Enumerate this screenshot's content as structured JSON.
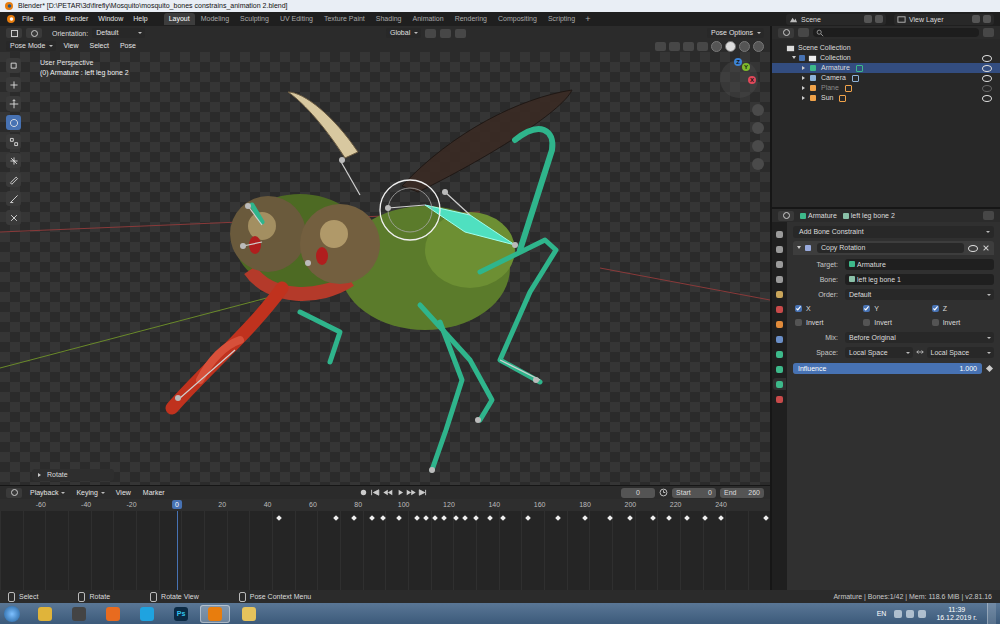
{
  "window": {
    "title": "Blender* [D:\\PETAR\\3d\\firefly\\Mosquito\\mosquito_bones constrains_animation 2.blend]"
  },
  "menu": [
    "File",
    "Edit",
    "Render",
    "Window",
    "Help"
  ],
  "workspaces": [
    {
      "label": "Layout",
      "selected": true
    },
    {
      "label": "Modeling",
      "selected": false
    },
    {
      "label": "Sculpting",
      "selected": false
    },
    {
      "label": "UV Editing",
      "selected": false
    },
    {
      "label": "Texture Paint",
      "selected": false
    },
    {
      "label": "Shading",
      "selected": false
    },
    {
      "label": "Animation",
      "selected": false
    },
    {
      "label": "Rendering",
      "selected": false
    },
    {
      "label": "Compositing",
      "selected": false
    },
    {
      "label": "Scripting",
      "selected": false
    }
  ],
  "add_workspace": "+",
  "scene": "Scene",
  "view_layer": "View Layer",
  "viewport": {
    "orientation_label": "Orientation:",
    "orientation": "Default",
    "transform_orientation": "Global",
    "pose_options": "Pose Options",
    "mode": "Pose Mode",
    "menus": [
      "View",
      "Select",
      "Pose"
    ],
    "perspective": "User Perspective",
    "active": "(0) Armature : left leg bone 2",
    "tools": [
      {
        "selected": false
      },
      {
        "selected": false
      },
      {
        "selected": false
      },
      {
        "selected": true
      },
      {
        "selected": false
      },
      {
        "selected": false
      },
      {
        "selected": false
      },
      {
        "selected": false
      },
      {
        "selected": false
      }
    ],
    "gizmo": [
      {
        "label": "X",
        "color": "#e0485a"
      },
      {
        "label": "Y",
        "color": "#7fba2c"
      },
      {
        "label": "Z",
        "color": "#3c83d6"
      }
    ],
    "last_operator": {
      "label": "Rotate",
      "expanded": false
    }
  },
  "timeline": {
    "menus": [
      "Playback",
      "Keying",
      "View",
      "Marker"
    ],
    "current_frame": "0",
    "start_label": "Start",
    "start": "0",
    "end_label": "End",
    "end": "260",
    "playhead": "0",
    "ruler": [
      "-60",
      "-40",
      "-20",
      "20",
      "40",
      "60",
      "80",
      "100",
      "120",
      "140",
      "160",
      "180",
      "200",
      "220",
      "240"
    ],
    "keyframes": [
      45,
      70,
      78,
      86,
      91,
      98,
      106,
      110,
      114,
      118,
      123,
      127,
      132,
      138,
      144,
      155,
      168,
      180,
      191,
      200,
      210,
      217,
      225,
      233,
      240,
      260
    ]
  },
  "outliner": {
    "root": "Scene Collection",
    "collection": {
      "label": "Collection",
      "expanded": true,
      "items": [
        {
          "label": "Armature",
          "selected": true,
          "visible": true
        },
        {
          "label": "Camera",
          "selected": false,
          "visible": true
        },
        {
          "label": "Plane",
          "selected": false,
          "visible": false
        },
        {
          "label": "Sun",
          "selected": false,
          "visible": true
        }
      ]
    }
  },
  "properties": {
    "object": "Armature",
    "bone": "left leg bone 2",
    "tabs": [
      {
        "selected": false
      },
      {
        "selected": false
      },
      {
        "selected": false
      },
      {
        "selected": false
      },
      {
        "selected": false
      },
      {
        "selected": false
      },
      {
        "selected": false
      },
      {
        "selected": false
      },
      {
        "selected": false
      },
      {
        "selected": false
      },
      {
        "selected": true
      },
      {
        "selected": false
      }
    ],
    "add_constraint": "Add Bone Constraint",
    "constraint": {
      "name": "Copy Rotation",
      "expanded": true,
      "fields": [
        {
          "label": "Target:",
          "value": "Armature"
        },
        {
          "label": "Bone:",
          "value": "left leg bone 1"
        },
        {
          "label": "Order:",
          "value": "Default"
        }
      ],
      "axes": [
        {
          "label": "X",
          "checked": true,
          "invert_label": "Invert",
          "invert": false
        },
        {
          "label": "Y",
          "checked": true,
          "invert_label": "Invert",
          "invert": false
        },
        {
          "label": "Z",
          "checked": true,
          "invert_label": "Invert",
          "invert": false
        }
      ],
      "mix": {
        "label": "Mix:",
        "value": "Before Original"
      },
      "space": {
        "label": "Space:",
        "owner": "Local Space",
        "target": "Local Space"
      },
      "influence": {
        "label": "Influence",
        "reading": "1.000",
        "level": 1
      }
    }
  },
  "status_bar": {
    "hints": [
      "Select",
      "Rotate",
      "Rotate View",
      "Pose Context Menu"
    ],
    "stats": "Armature | Bones:1/42 | Mem: 118.6 MiB | v2.81.16"
  },
  "taskbar": {
    "apps": [
      {
        "label": "",
        "active": false
      },
      {
        "label": "",
        "active": false
      },
      {
        "label": "",
        "active": false
      },
      {
        "label": "",
        "active": false
      },
      {
        "label": "Ps",
        "active": false
      },
      {
        "label": "",
        "active": true
      },
      {
        "label": "",
        "active": false
      }
    ],
    "language": "EN",
    "time": "11:39",
    "date": "16.12.2019 г."
  }
}
